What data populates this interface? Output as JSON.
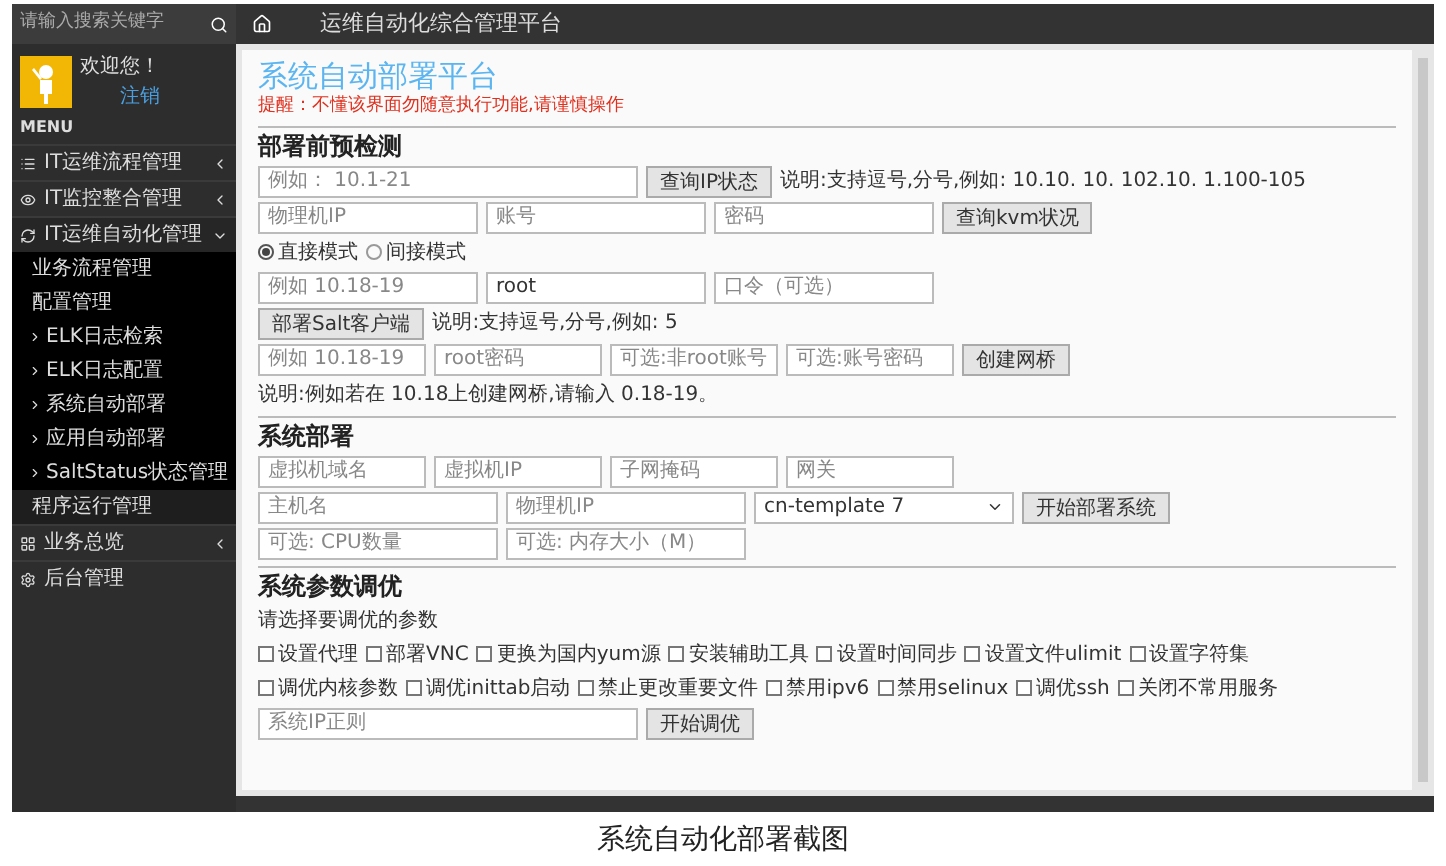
{
  "sidebar": {
    "search": {
      "placeholder": "请输入搜索关键字"
    },
    "user": {
      "greeting": "欢迎您！",
      "logout": "注销"
    },
    "menu_label": "MENU",
    "items": [
      {
        "label": "IT运维流程管理",
        "kind": "group",
        "expanded": false
      },
      {
        "label": "IT监控整合管理",
        "kind": "group",
        "expanded": false
      },
      {
        "label": "IT运维自动化管理",
        "kind": "group",
        "expanded": true,
        "children": [
          {
            "label": "业务流程管理",
            "kind": "page",
            "selected": false
          },
          {
            "label": "配置管理",
            "kind": "page",
            "selected": false
          },
          {
            "label": "ELK日志检索",
            "kind": "folder",
            "selected": false
          },
          {
            "label": "ELK日志配置",
            "kind": "folder",
            "selected": false
          },
          {
            "label": "系统自动部署",
            "kind": "folder",
            "selected": false
          },
          {
            "label": "应用自动部署",
            "kind": "folder",
            "selected": false
          },
          {
            "label": "SaltStatus状态管理",
            "kind": "folder",
            "selected": false
          },
          {
            "label": "程序运行管理",
            "kind": "page",
            "selected": true
          }
        ]
      },
      {
        "label": "业务总览",
        "kind": "group",
        "expanded": false
      },
      {
        "label": "后台管理",
        "kind": "page"
      }
    ]
  },
  "topbar": {
    "title": "运维自动化综合管理平台"
  },
  "main": {
    "title": "系统自动部署平台",
    "warning": "提醒：不懂该界面勿随意执行功能,请谨慎操作",
    "sections": [
      {
        "heading": "部署前预检测",
        "rows": [
          {
            "items": [
              {
                "kind": "input",
                "placeholder": "例如： 10.1-21"
              },
              {
                "kind": "button",
                "label": "查询IP状态"
              },
              {
                "kind": "note",
                "text": "说明:支持逗号,分号,例如: 10.10. 10. 102.10. 1.100-105"
              }
            ]
          },
          {
            "items": [
              {
                "kind": "input",
                "placeholder": "物理机IP"
              },
              {
                "kind": "input",
                "placeholder": "账号"
              },
              {
                "kind": "input",
                "placeholder": "密码"
              },
              {
                "kind": "button",
                "label": "查询kvm状况"
              }
            ]
          },
          {
            "items": [
              {
                "kind": "radio",
                "label": "直接模式",
                "selected": true
              },
              {
                "kind": "radio",
                "label": "间接模式",
                "selected": false
              }
            ]
          },
          {
            "items": [
              {
                "kind": "input",
                "placeholder": "例如 10.18-19"
              },
              {
                "kind": "input",
                "value": "root"
              },
              {
                "kind": "input",
                "placeholder": "口令（可选）"
              }
            ]
          },
          {
            "items": [
              {
                "kind": "button",
                "label": "部署Salt客户端"
              },
              {
                "kind": "note",
                "text": "说明:支持逗号,分号,例如: 5"
              }
            ]
          },
          {
            "items": [
              {
                "kind": "input",
                "placeholder": "例如 10.18-19"
              },
              {
                "kind": "input",
                "placeholder": "root密码"
              },
              {
                "kind": "input",
                "placeholder": "可选:非root账号"
              },
              {
                "kind": "input",
                "placeholder": "可选:账号密码"
              },
              {
                "kind": "button",
                "label": "创建网桥"
              },
              {
                "kind": "note",
                "text": "说明:例如若在 10.18上创建网桥,请输入 0.18-19。"
              }
            ]
          }
        ]
      },
      {
        "heading": "系统部署",
        "rows": [
          {
            "items": [
              {
                "kind": "input",
                "placeholder": "虚拟机域名"
              },
              {
                "kind": "input",
                "placeholder": "虚拟机IP"
              },
              {
                "kind": "input",
                "placeholder": "子网掩码"
              },
              {
                "kind": "input",
                "placeholder": "网关"
              }
            ]
          },
          {
            "items": [
              {
                "kind": "input",
                "placeholder": "主机名"
              },
              {
                "kind": "input",
                "placeholder": "物理机IP"
              },
              {
                "kind": "select",
                "value": "cn-template 7"
              },
              {
                "kind": "button",
                "label": "开始部署系统"
              }
            ]
          },
          {
            "items": [
              {
                "kind": "input",
                "placeholder": "可选: CPU数量"
              },
              {
                "kind": "input",
                "placeholder": "可选: 内存大小（M）"
              }
            ]
          }
        ]
      },
      {
        "heading": "系统参数调优",
        "rows": [
          {
            "items": [
              {
                "kind": "note",
                "text": "请选择要调优的参数"
              }
            ]
          },
          {
            "items": [
              {
                "kind": "checkbox",
                "label": "设置代理",
                "checked": false
              },
              {
                "kind": "checkbox",
                "label": "部署VNC",
                "checked": false
              },
              {
                "kind": "checkbox",
                "label": "更换为国内yum源",
                "checked": false
              },
              {
                "kind": "checkbox",
                "label": "安装辅助工具",
                "checked": false
              },
              {
                "kind": "checkbox",
                "label": "设置时间同步",
                "checked": false
              },
              {
                "kind": "checkbox",
                "label": "设置文件ulimit",
                "checked": false
              },
              {
                "kind": "checkbox",
                "label": "设置字符集",
                "checked": false
              },
              {
                "kind": "checkbox",
                "label": "调优内核参数",
                "checked": false
              },
              {
                "kind": "checkbox",
                "label": "调优inittab启动",
                "checked": false
              },
              {
                "kind": "checkbox",
                "label": "禁止更改重要文件",
                "checked": false
              },
              {
                "kind": "checkbox",
                "label": "禁用ipv6",
                "checked": false
              },
              {
                "kind": "checkbox",
                "label": "禁用selinux",
                "checked": false
              },
              {
                "kind": "checkbox",
                "label": "调优ssh",
                "checked": false
              },
              {
                "kind": "checkbox",
                "label": "关闭不常用服务",
                "checked": false
              }
            ]
          },
          {
            "items": [
              {
                "kind": "input",
                "placeholder": "系统IP正则"
              },
              {
                "kind": "button",
                "label": "开始调优"
              }
            ]
          }
        ]
      }
    ]
  },
  "caption": "系统自动化部署截图"
}
